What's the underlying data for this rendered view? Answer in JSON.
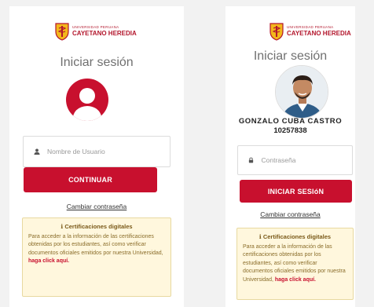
{
  "brand": {
    "sub": "UNIVERSIDAD PERUANA",
    "name": "CAYETANO HEREDIA",
    "primary_color": "#c8102e"
  },
  "login_step": {
    "title": "Iniciar sesión",
    "avatar_icon": "user-silhouette-icon",
    "username_placeholder": "Nombre de Usuario",
    "username_icon": "user-icon",
    "continue_label": "CONTINUAR",
    "change_password_link": "Cambiar contraseña",
    "info": {
      "icon": "info-icon",
      "title": "Certificaciones digitales",
      "body": "Para acceder a la información de las certificaciones obtenidas por los estudiantes, así como verificar documentos oficiales emitidos por nuestra Universidad,",
      "link": "haga click aquí."
    }
  },
  "password_step": {
    "back_icon": "back-arrow-icon",
    "title": "Iniciar sesión",
    "user_fullname": "GONZALO  CUBA  CASTRO",
    "user_code": "10257838",
    "password_placeholder": "Contraseña",
    "password_icon": "lock-icon",
    "login_label": "INICIAR SESIóN",
    "change_password_link": "Cambiar contraseña",
    "info": {
      "icon": "info-icon",
      "title": "Certificaciones digitales",
      "body": "Para acceder a la información de las certificaciones obtenidas por los estudiantes, así como verificar documentos oficiales emitidos por nuestra Universidad,",
      "link": "haga click aquí."
    }
  }
}
